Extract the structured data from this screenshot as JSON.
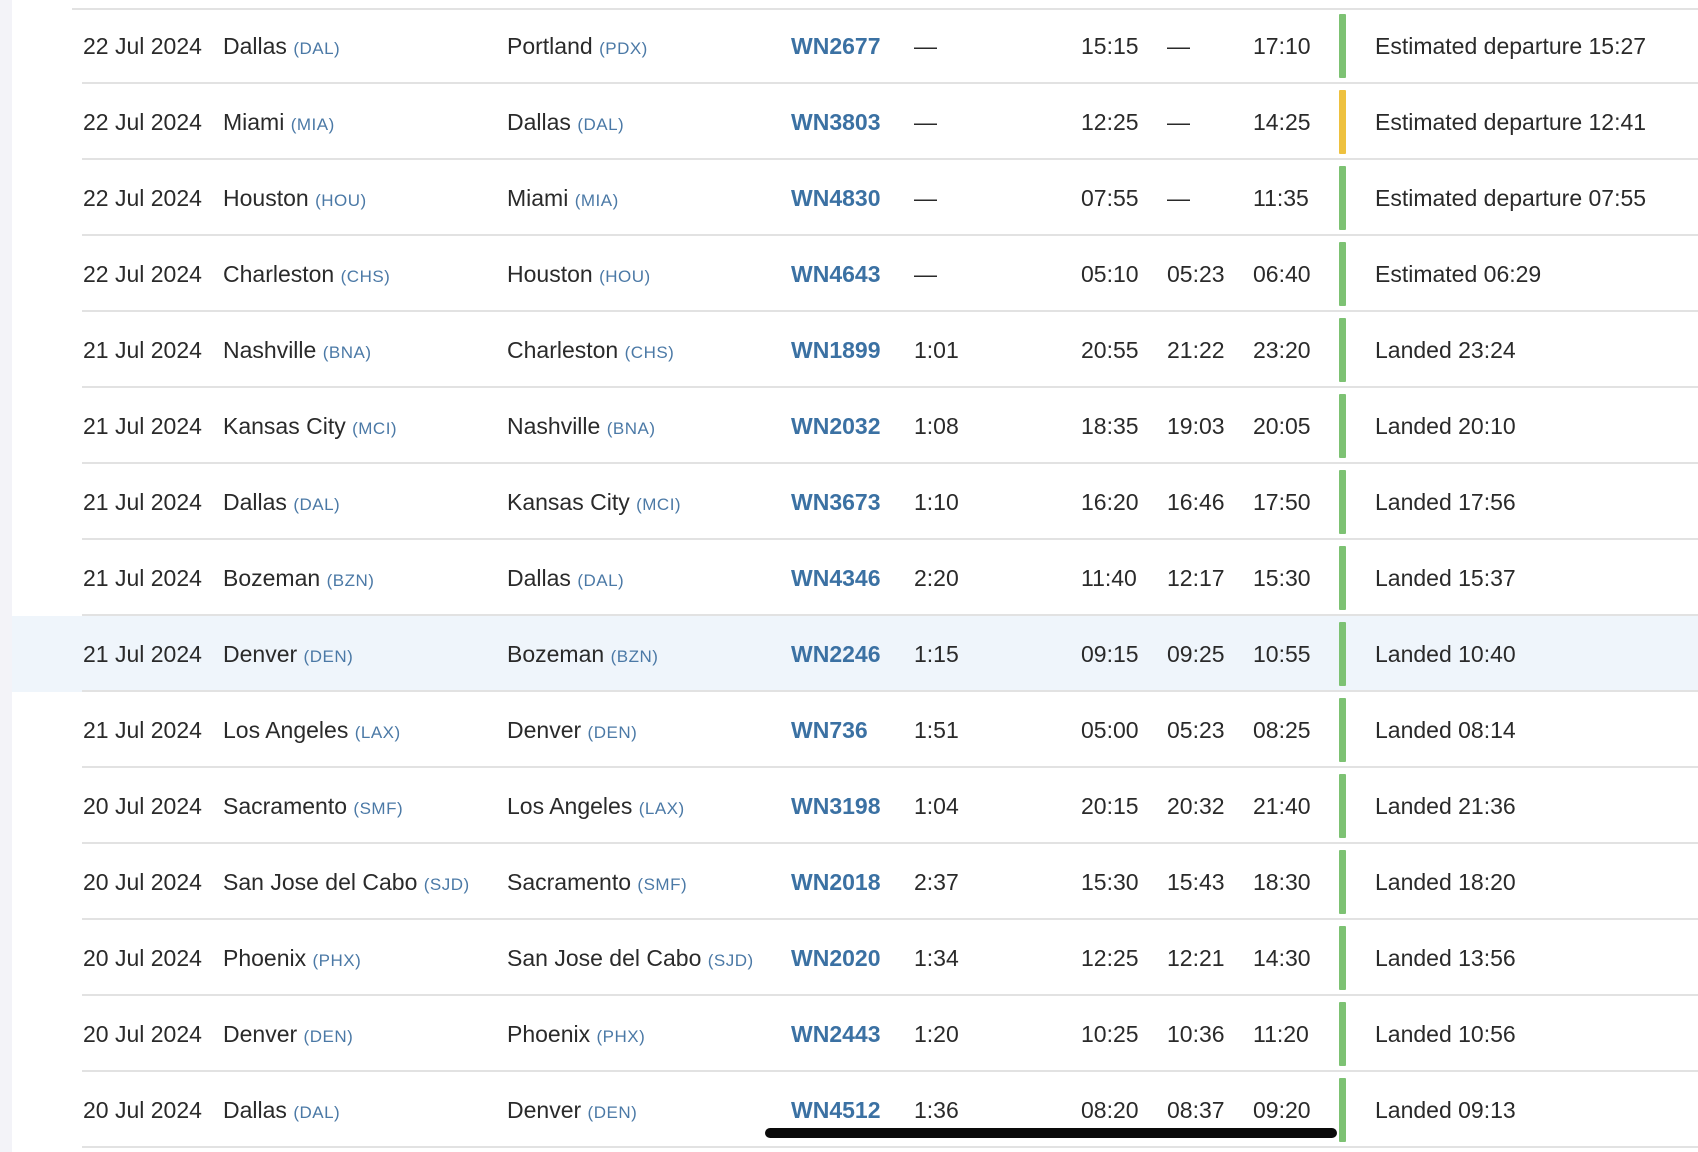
{
  "colors": {
    "on_time": "#7dc273",
    "delayed": "#eec13f",
    "flight_link": "#3b71a3"
  },
  "rows": [
    {
      "date": "22 Jul 2024",
      "from_city": "Dallas",
      "from_code": "(DAL)",
      "to_city": "Portland",
      "to_code": "(PDX)",
      "flight": "WN2677",
      "duration": "—",
      "sched_dep": "15:15",
      "actual_dep": "—",
      "sched_arr": "17:10",
      "status_color": "on_time",
      "status": "Estimated departure 15:27"
    },
    {
      "date": "22 Jul 2024",
      "from_city": "Miami",
      "from_code": "(MIA)",
      "to_city": "Dallas",
      "to_code": "(DAL)",
      "flight": "WN3803",
      "duration": "—",
      "sched_dep": "12:25",
      "actual_dep": "—",
      "sched_arr": "14:25",
      "status_color": "delayed",
      "status": "Estimated departure 12:41"
    },
    {
      "date": "22 Jul 2024",
      "from_city": "Houston",
      "from_code": "(HOU)",
      "to_city": "Miami",
      "to_code": "(MIA)",
      "flight": "WN4830",
      "duration": "—",
      "sched_dep": "07:55",
      "actual_dep": "—",
      "sched_arr": "11:35",
      "status_color": "on_time",
      "status": "Estimated departure 07:55"
    },
    {
      "date": "22 Jul 2024",
      "from_city": "Charleston",
      "from_code": "(CHS)",
      "to_city": "Houston",
      "to_code": "(HOU)",
      "flight": "WN4643",
      "duration": "—",
      "sched_dep": "05:10",
      "actual_dep": "05:23",
      "sched_arr": "06:40",
      "status_color": "on_time",
      "status": "Estimated 06:29"
    },
    {
      "date": "21 Jul 2024",
      "from_city": "Nashville",
      "from_code": "(BNA)",
      "to_city": "Charleston",
      "to_code": "(CHS)",
      "flight": "WN1899",
      "duration": "1:01",
      "sched_dep": "20:55",
      "actual_dep": "21:22",
      "sched_arr": "23:20",
      "status_color": "on_time",
      "status": "Landed 23:24"
    },
    {
      "date": "21 Jul 2024",
      "from_city": "Kansas City",
      "from_code": "(MCI)",
      "to_city": "Nashville",
      "to_code": "(BNA)",
      "flight": "WN2032",
      "duration": "1:08",
      "sched_dep": "18:35",
      "actual_dep": "19:03",
      "sched_arr": "20:05",
      "status_color": "on_time",
      "status": "Landed 20:10"
    },
    {
      "date": "21 Jul 2024",
      "from_city": "Dallas",
      "from_code": "(DAL)",
      "to_city": "Kansas City",
      "to_code": "(MCI)",
      "flight": "WN3673",
      "duration": "1:10",
      "sched_dep": "16:20",
      "actual_dep": "16:46",
      "sched_arr": "17:50",
      "status_color": "on_time",
      "status": "Landed 17:56"
    },
    {
      "date": "21 Jul 2024",
      "from_city": "Bozeman",
      "from_code": "(BZN)",
      "to_city": "Dallas",
      "to_code": "(DAL)",
      "flight": "WN4346",
      "duration": "2:20",
      "sched_dep": "11:40",
      "actual_dep": "12:17",
      "sched_arr": "15:30",
      "status_color": "on_time",
      "status": "Landed 15:37"
    },
    {
      "date": "21 Jul 2024",
      "from_city": "Denver",
      "from_code": "(DEN)",
      "to_city": "Bozeman",
      "to_code": "(BZN)",
      "flight": "WN2246",
      "duration": "1:15",
      "sched_dep": "09:15",
      "actual_dep": "09:25",
      "sched_arr": "10:55",
      "status_color": "on_time",
      "status": "Landed 10:40",
      "highlighted": true
    },
    {
      "date": "21 Jul 2024",
      "from_city": "Los Angeles",
      "from_code": "(LAX)",
      "to_city": "Denver",
      "to_code": "(DEN)",
      "flight": "WN736",
      "duration": "1:51",
      "sched_dep": "05:00",
      "actual_dep": "05:23",
      "sched_arr": "08:25",
      "status_color": "on_time",
      "status": "Landed 08:14"
    },
    {
      "date": "20 Jul 2024",
      "from_city": "Sacramento",
      "from_code": "(SMF)",
      "to_city": "Los Angeles",
      "to_code": "(LAX)",
      "flight": "WN3198",
      "duration": "1:04",
      "sched_dep": "20:15",
      "actual_dep": "20:32",
      "sched_arr": "21:40",
      "status_color": "on_time",
      "status": "Landed 21:36"
    },
    {
      "date": "20 Jul 2024",
      "from_city": "San Jose del Cabo",
      "from_code": "(SJD)",
      "to_city": "Sacramento",
      "to_code": "(SMF)",
      "flight": "WN2018",
      "duration": "2:37",
      "sched_dep": "15:30",
      "actual_dep": "15:43",
      "sched_arr": "18:30",
      "status_color": "on_time",
      "status": "Landed 18:20"
    },
    {
      "date": "20 Jul 2024",
      "from_city": "Phoenix",
      "from_code": "(PHX)",
      "to_city": "San Jose del Cabo",
      "to_code": "(SJD)",
      "flight": "WN2020",
      "duration": "1:34",
      "sched_dep": "12:25",
      "actual_dep": "12:21",
      "sched_arr": "14:30",
      "status_color": "on_time",
      "status": "Landed 13:56"
    },
    {
      "date": "20 Jul 2024",
      "from_city": "Denver",
      "from_code": "(DEN)",
      "to_city": "Phoenix",
      "to_code": "(PHX)",
      "flight": "WN2443",
      "duration": "1:20",
      "sched_dep": "10:25",
      "actual_dep": "10:36",
      "sched_arr": "11:20",
      "status_color": "on_time",
      "status": "Landed 10:56"
    },
    {
      "date": "20 Jul 2024",
      "from_city": "Dallas",
      "from_code": "(DAL)",
      "to_city": "Denver",
      "to_code": "(DEN)",
      "flight": "WN4512",
      "duration": "1:36",
      "sched_dep": "08:20",
      "actual_dep": "08:37",
      "sched_arr": "09:20",
      "status_color": "on_time",
      "status": "Landed 09:13"
    }
  ]
}
